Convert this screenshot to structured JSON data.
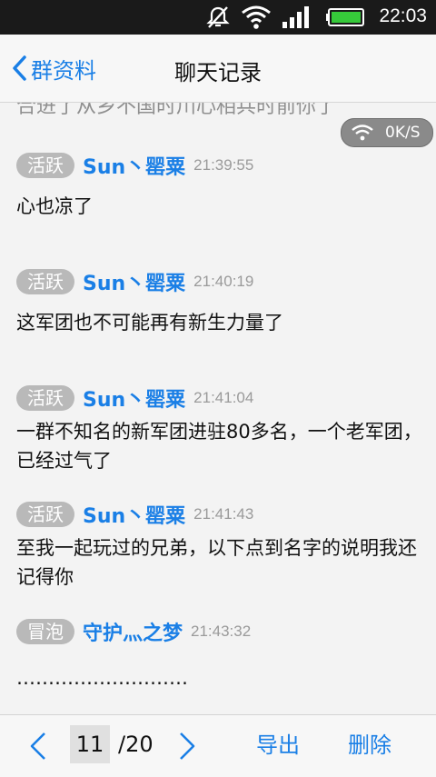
{
  "status_bar": {
    "time": "22:03",
    "icons": [
      "muted-bell-icon",
      "wifi-icon",
      "signal-icon",
      "battery-icon"
    ]
  },
  "nav": {
    "back_label": "群资料",
    "title": "聊天记录"
  },
  "colors": {
    "accent": "#1a7fe6",
    "badge": "#b9b9b9",
    "text": "#111111",
    "timestamp": "#9a9a9a"
  },
  "partial_text": "合进了从乡不国时川心相兵时前你了",
  "speed_indicator": "0K/S",
  "messages": [
    {
      "badge": "活跃",
      "sender": "Sun丶罂粟",
      "time": "21:39:55",
      "text": "心也凉了"
    },
    {
      "badge": "活跃",
      "sender": "Sun丶罂粟",
      "time": "21:40:19",
      "text": "这军团也不可能再有新生力量了"
    },
    {
      "badge": "活跃",
      "sender": "Sun丶罂粟",
      "time": "21:41:04",
      "text": "一群不知名的新军团进驻80多名，一个老军团，已经过气了"
    },
    {
      "badge": "活跃",
      "sender": "Sun丶罂粟",
      "time": "21:41:43",
      "text": "至我一起玩过的兄弟，以下点到名字的说明我还记得你"
    },
    {
      "badge": "冒泡",
      "sender": "守护灬之梦",
      "time": "21:43:32",
      "text": "………………………"
    }
  ],
  "pager": {
    "current": "11",
    "total": "/20",
    "export_label": "导出",
    "delete_label": "删除"
  }
}
